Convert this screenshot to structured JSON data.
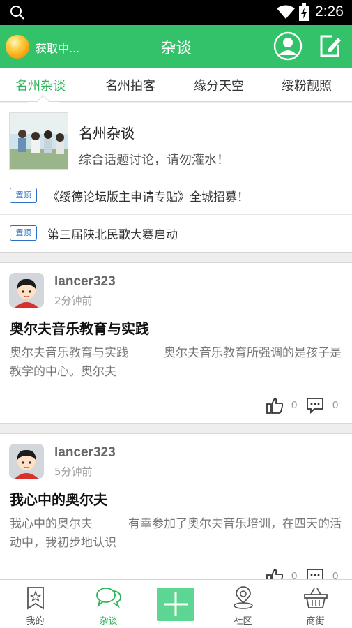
{
  "status_bar": {
    "time": "2:26",
    "icons": [
      "search-icon",
      "wifi-icon",
      "battery-icon"
    ]
  },
  "header": {
    "weather_text": "获取中...",
    "title": "杂谈",
    "icons": [
      "weather-orb-icon",
      "user-profile-icon",
      "compose-icon"
    ]
  },
  "tabs": [
    {
      "label": "名州杂谈",
      "active": true
    },
    {
      "label": "名州拍客",
      "active": false
    },
    {
      "label": "缘分天空",
      "active": false
    },
    {
      "label": "绥粉靓照",
      "active": false
    }
  ],
  "forum": {
    "name": "名州杂谈",
    "description": "综合话题讨论，请勿灌水！",
    "pinned": [
      {
        "badge": "置顶",
        "text": "《绥德论坛版主申请专贴》全城招募！"
      },
      {
        "badge": "置顶",
        "text": "第三届陕北民歌大赛启动"
      }
    ]
  },
  "posts": [
    {
      "author": "lancer323",
      "time": "2分钟前",
      "title": "奥尔夫音乐教育与实践",
      "excerpt": "奥尔夫音乐教育与实践　　　奥尔夫音乐教育所强调的是孩子是教学的中心。奥尔夫",
      "likes": "0",
      "comments": "0"
    },
    {
      "author": "lancer323",
      "time": "5分钟前",
      "title": "我心中的奥尔夫",
      "excerpt": "我心中的奥尔夫　　　有幸参加了奥尔夫音乐培训，在四天的活动中，我初步地认识",
      "likes": "0",
      "comments": "0"
    }
  ],
  "bottom_nav": [
    {
      "label": "我的",
      "icon": "bookmark-star-icon",
      "active": false
    },
    {
      "label": "杂谈",
      "icon": "chat-bubbles-icon",
      "active": true
    },
    {
      "label": "",
      "icon": "plus-icon",
      "active": false
    },
    {
      "label": "社区",
      "icon": "location-pin-icon",
      "active": false
    },
    {
      "label": "商街",
      "icon": "shopping-basket-icon",
      "active": false
    }
  ],
  "colors": {
    "accent_green": "#33c26a",
    "active_tab_green": "#2db35a",
    "pin_blue": "#2b6fc4",
    "add_button_green": "#5cd692"
  }
}
